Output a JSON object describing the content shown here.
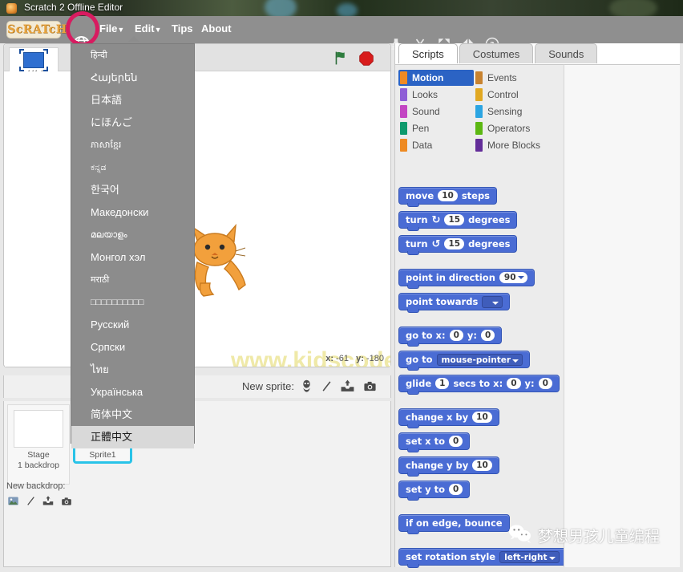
{
  "window": {
    "title": "Scratch 2 Offline Editor",
    "icon": "scratch-app-icon"
  },
  "menubar": {
    "logo": "ScRATcH",
    "globe_icon": "globe-icon",
    "items": [
      {
        "label": "File",
        "caret": "▼"
      },
      {
        "label": "Edit",
        "caret": "▼"
      },
      {
        "label": "Tips",
        "caret": ""
      },
      {
        "label": "About",
        "caret": ""
      }
    ],
    "tool_icons": [
      "stamp-icon",
      "scissors-icon",
      "grow-icon",
      "shrink-icon",
      "help-icon"
    ]
  },
  "language_menu": {
    "items": [
      {
        "label": "हिन्दी",
        "small": true,
        "highlighted": false
      },
      {
        "label": "Հայերեն",
        "small": false,
        "highlighted": false
      },
      {
        "label": "日本語",
        "small": false,
        "highlighted": false
      },
      {
        "label": "にほんご",
        "small": false,
        "highlighted": false
      },
      {
        "label": "ភាសាខ្មែរ",
        "small": true,
        "highlighted": false
      },
      {
        "label": "ಕನ್ನಡ",
        "small": true,
        "highlighted": false
      },
      {
        "label": "한국어",
        "small": false,
        "highlighted": false
      },
      {
        "label": "Македонски",
        "small": false,
        "highlighted": false
      },
      {
        "label": "മലയാളം",
        "small": true,
        "highlighted": false
      },
      {
        "label": "Монгол хэл",
        "small": false,
        "highlighted": false
      },
      {
        "label": "मराठी",
        "small": true,
        "highlighted": false
      },
      {
        "label": "□□□□□□□□□□",
        "small": true,
        "highlighted": false
      },
      {
        "label": "Русский",
        "small": false,
        "highlighted": false
      },
      {
        "label": "Српски",
        "small": false,
        "highlighted": false
      },
      {
        "label": "ไทย",
        "small": false,
        "highlighted": false
      },
      {
        "label": "Українська",
        "small": false,
        "highlighted": false
      },
      {
        "label": "简体中文",
        "small": false,
        "highlighted": false
      },
      {
        "label": "正體中文",
        "small": false,
        "highlighted": true
      }
    ],
    "annotation_color": "#d81b60"
  },
  "stage": {
    "sprite_thumb_label": "v441.1",
    "green_flag_icon": "green-flag-icon",
    "stop_icon": "stop-sign-icon",
    "coords": {
      "x_label": "x:",
      "x_value": "-61",
      "y_label": "y:",
      "y_value": "-180"
    },
    "watermark": "www.kidscode.cn"
  },
  "new_sprite_bar": {
    "label": "New sprite:",
    "icons": [
      "sprite-library-icon",
      "paint-sprite-icon",
      "upload-sprite-icon",
      "camera-sprite-icon"
    ]
  },
  "sprite_panel": {
    "stage": {
      "name": "Stage",
      "sub": "1 backdrop"
    },
    "new_backdrop_label": "New backdrop:",
    "new_backdrop_icons": [
      "backdrop-library-icon",
      "paint-backdrop-icon",
      "upload-backdrop-icon",
      "camera-backdrop-icon"
    ],
    "sprites": [
      {
        "name": "Sprite1",
        "selected": true
      }
    ]
  },
  "scripts_panel": {
    "tabs": [
      {
        "label": "Scripts",
        "active": true
      },
      {
        "label": "Costumes",
        "active": false
      },
      {
        "label": "Sounds",
        "active": false
      }
    ],
    "categories_left": [
      {
        "label": "Motion",
        "color": "#4a6cd4",
        "selected": true
      },
      {
        "label": "Looks",
        "color": "#8e5ed6",
        "selected": false
      },
      {
        "label": "Sound",
        "color": "#c346c3",
        "selected": false
      },
      {
        "label": "Pen",
        "color": "#0e9a6c",
        "selected": false
      },
      {
        "label": "Data",
        "color": "#ee8a22",
        "selected": false
      }
    ],
    "categories_right": [
      {
        "label": "Events",
        "color": "#c88330",
        "selected": false
      },
      {
        "label": "Control",
        "color": "#e1a822",
        "selected": false
      },
      {
        "label": "Sensing",
        "color": "#2ca5e2",
        "selected": false
      },
      {
        "label": "Operators",
        "color": "#5cb712",
        "selected": false
      },
      {
        "label": "More Blocks",
        "color": "#632d99",
        "selected": false
      }
    ],
    "blocks": [
      {
        "id": "move",
        "parts": [
          {
            "t": "text",
            "v": "move"
          },
          {
            "t": "oval",
            "v": "10"
          },
          {
            "t": "text",
            "v": "steps"
          }
        ]
      },
      {
        "id": "turn-cw",
        "parts": [
          {
            "t": "text",
            "v": "turn"
          },
          {
            "t": "icon",
            "v": "↻"
          },
          {
            "t": "oval",
            "v": "15"
          },
          {
            "t": "text",
            "v": "degrees"
          }
        ]
      },
      {
        "id": "turn-ccw",
        "parts": [
          {
            "t": "text",
            "v": "turn"
          },
          {
            "t": "icon",
            "v": "↺"
          },
          {
            "t": "oval",
            "v": "15"
          },
          {
            "t": "text",
            "v": "degrees"
          }
        ]
      },
      {
        "id": "spacer1",
        "parts": []
      },
      {
        "id": "point-dir",
        "parts": [
          {
            "t": "text",
            "v": "point in direction"
          },
          {
            "t": "ovdrop",
            "v": "90"
          }
        ]
      },
      {
        "id": "point-tow",
        "parts": [
          {
            "t": "text",
            "v": "point towards"
          },
          {
            "t": "drop",
            "v": ""
          }
        ]
      },
      {
        "id": "spacer2",
        "parts": []
      },
      {
        "id": "goto-xy",
        "parts": [
          {
            "t": "text",
            "v": "go to x:"
          },
          {
            "t": "oval",
            "v": "0"
          },
          {
            "t": "text",
            "v": "y:"
          },
          {
            "t": "oval",
            "v": "0"
          }
        ]
      },
      {
        "id": "goto-target",
        "parts": [
          {
            "t": "text",
            "v": "go to"
          },
          {
            "t": "drop",
            "v": "mouse-pointer"
          }
        ]
      },
      {
        "id": "glide",
        "parts": [
          {
            "t": "text",
            "v": "glide"
          },
          {
            "t": "oval",
            "v": "1"
          },
          {
            "t": "text",
            "v": "secs to x:"
          },
          {
            "t": "oval",
            "v": "0"
          },
          {
            "t": "text",
            "v": "y:"
          },
          {
            "t": "oval",
            "v": "0"
          }
        ]
      },
      {
        "id": "spacer3",
        "parts": []
      },
      {
        "id": "change-x",
        "parts": [
          {
            "t": "text",
            "v": "change x by"
          },
          {
            "t": "oval",
            "v": "10"
          }
        ]
      },
      {
        "id": "set-x",
        "parts": [
          {
            "t": "text",
            "v": "set x to"
          },
          {
            "t": "oval",
            "v": "0"
          }
        ]
      },
      {
        "id": "change-y",
        "parts": [
          {
            "t": "text",
            "v": "change y by"
          },
          {
            "t": "oval",
            "v": "10"
          }
        ]
      },
      {
        "id": "set-y",
        "parts": [
          {
            "t": "text",
            "v": "set y to"
          },
          {
            "t": "oval",
            "v": "0"
          }
        ]
      },
      {
        "id": "spacer4",
        "parts": []
      },
      {
        "id": "bounce",
        "parts": [
          {
            "t": "text",
            "v": "if on edge, bounce"
          }
        ]
      },
      {
        "id": "spacer5",
        "parts": []
      },
      {
        "id": "rot-style",
        "parts": [
          {
            "t": "text",
            "v": "set rotation style"
          },
          {
            "t": "drop",
            "v": "left-right"
          }
        ]
      }
    ]
  },
  "watermarks": {
    "wechat_text": "梦想男孩儿童编程",
    "wechat_icon": "wechat-icon"
  }
}
